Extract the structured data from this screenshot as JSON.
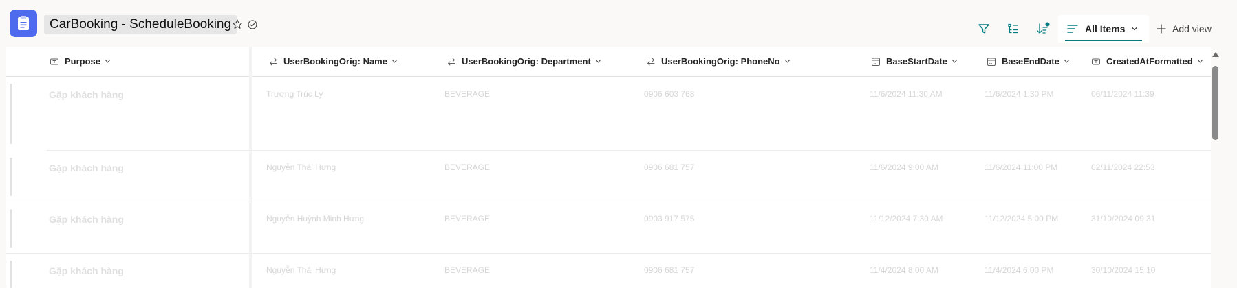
{
  "app": {
    "title": "CarBooking - ScheduleBooking",
    "icon": "clipboard-icon",
    "accent_color": "#4f6bed"
  },
  "toolbar": {
    "buttons": [
      {
        "icon": "filter-icon"
      },
      {
        "icon": "group-by-icon"
      },
      {
        "icon": "sort-icon"
      }
    ],
    "view_name": "All Items",
    "add_view_label": "Add view",
    "accent_color": "#037c80"
  },
  "columns": [
    {
      "label": "Purpose",
      "icon": "text-field-icon"
    },
    {
      "label": "UserBookingOrig: Name",
      "icon": "lookup-icon"
    },
    {
      "label": "UserBookingOrig: Department",
      "icon": "lookup-icon"
    },
    {
      "label": "UserBookingOrig: PhoneNo",
      "icon": "lookup-icon"
    },
    {
      "label": "BaseStartDate",
      "icon": "calendar-icon"
    },
    {
      "label": "BaseEndDate",
      "icon": "calendar-icon"
    },
    {
      "label": "CreatedAtFormatted",
      "icon": "text-field-icon"
    }
  ],
  "rows": [
    {
      "purpose": "Gặp khách hàng",
      "name": "Trương Trúc Ly",
      "department": "BEVERAGE",
      "phone": "0906 603 768",
      "start": "11/6/2024 11:30 AM",
      "end": "11/6/2024 1:30 PM",
      "created": "06/11/2024 11:39"
    },
    {
      "purpose": "Gặp khách hàng",
      "name": "Nguyễn Thái Hưng",
      "department": "BEVERAGE",
      "phone": "0906 681 757",
      "start": "11/6/2024 9:00 AM",
      "end": "11/6/2024 11:00 PM",
      "created": "02/11/2024 22:53"
    },
    {
      "purpose": "Gặp khách hàng",
      "name": "Nguyễn Huỳnh Minh Hưng",
      "department": "BEVERAGE",
      "phone": "0903 917 575",
      "start": "11/12/2024 7:30 AM",
      "end": "11/12/2024 5:00 PM",
      "created": "31/10/2024 09:31"
    },
    {
      "purpose": "Gặp khách hàng",
      "name": "Nguyễn Thái Hưng",
      "department": "BEVERAGE",
      "phone": "0906 681 757",
      "start": "11/4/2024 8:00 AM",
      "end": "11/4/2024 6:00 PM",
      "created": "30/10/2024 15:10"
    }
  ]
}
